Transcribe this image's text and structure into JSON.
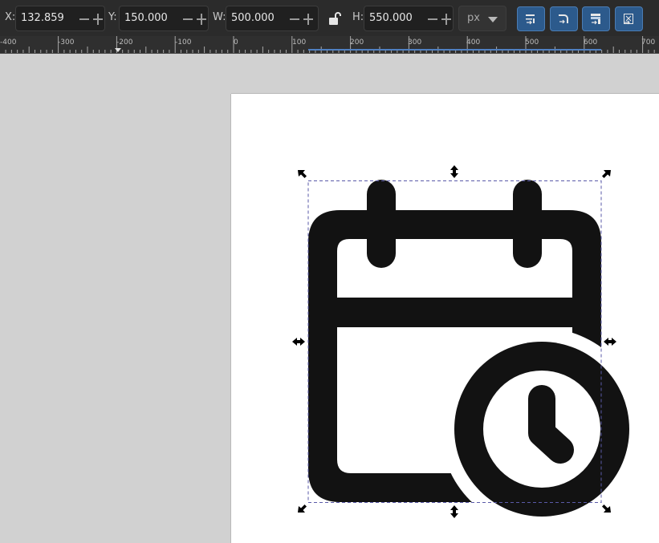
{
  "toolbar": {
    "x": {
      "label": "X:",
      "value": "132.859"
    },
    "y": {
      "label": "Y:",
      "value": "150.000"
    },
    "w": {
      "label": "W:",
      "value": "500.000"
    },
    "h": {
      "label": "H:",
      "value": "550.000"
    },
    "unit": "px",
    "lock_icon": "unlocked-lock-icon",
    "scale_buttons": [
      "scale-stroke-icon",
      "scale-corners-icon",
      "move-gradients-icon",
      "move-patterns-icon"
    ]
  },
  "ruler": {
    "labels": [
      "-400",
      "-300",
      "-200",
      "-100",
      "0",
      "100",
      "200",
      "300",
      "400",
      "500",
      "600",
      "700"
    ]
  },
  "canvas": {
    "object": "calendar-clock-icon",
    "fill_color": "#121212",
    "page_color": "#ffffff",
    "selection_color": "#5a5aa8"
  }
}
